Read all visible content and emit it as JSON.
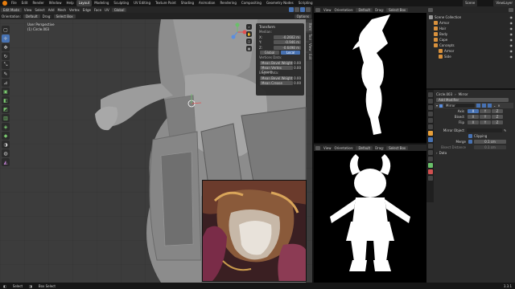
{
  "menu": {
    "items": [
      "File",
      "Edit",
      "Render",
      "Window",
      "Help"
    ],
    "workspaces": [
      "Layout",
      "Modeling",
      "Sculpting",
      "UV Editing",
      "Texture Paint",
      "Shading",
      "Animation",
      "Rendering",
      "Compositing",
      "Geometry Nodes",
      "Scripting"
    ],
    "active_workspace": "Layout",
    "scene_label": "Scene",
    "view_layer_label": "ViewLayer"
  },
  "viewport": {
    "mode": "Edit Mode",
    "menus": [
      "View",
      "Select",
      "Add",
      "Mesh",
      "Vertex",
      "Edge",
      "Face",
      "UV"
    ],
    "orientation_label": "Orientation:",
    "orientation_value": "Default",
    "drag_label": "Drag:",
    "drag_value": "Select Box",
    "transform_global": "Global",
    "options_label": "Options",
    "view_name": "User Perspective",
    "object_name": "(1) Circle.003"
  },
  "npanel": {
    "header": "Transform",
    "median_label": "Median:",
    "x_label": "X:",
    "x_value": "-0.2602 m",
    "y_label": "Y:",
    "y_value": "-0.946 m",
    "z_label": "Z:",
    "z_value": "-0.6498 m",
    "global_btn": "Global",
    "local_btn": "Local",
    "vertices_data": "Vertices Data:",
    "mean_bevel_weight_v": "Mean Bevel Weight",
    "mean_bevel_weight_v_val": "0.00",
    "mean_vertex_crease": "Mean Vertex Crease",
    "mean_vertex_crease_val": "0.00",
    "edges_data": "Edges Data:",
    "mean_bevel_weight_e": "Mean Bevel Weight",
    "mean_bevel_weight_e_val": "0.00",
    "mean_crease": "Mean Crease",
    "mean_crease_val": "0.00",
    "tabs": [
      "Item",
      "Tool",
      "View",
      "Edit"
    ]
  },
  "image_editor_top": {
    "view_menu": "View",
    "orientation_label": "Orientation:",
    "orientation_value": "Default",
    "drag_label": "Drag:",
    "drag_value": "Select Box"
  },
  "image_editor_bottom": {
    "view_menu": "View",
    "orientation_label": "Orientation:",
    "orientation_value": "Default",
    "drag_label": "Drag:",
    "drag_value": "Select Box"
  },
  "outliner": {
    "items": [
      {
        "label": "Scene Collection",
        "indent": 0,
        "color": "#9a9a9a"
      },
      {
        "label": "Armor",
        "indent": 1,
        "color": "#d9913c"
      },
      {
        "label": "Hair",
        "indent": 1,
        "color": "#d9913c"
      },
      {
        "label": "Body",
        "indent": 1,
        "color": "#d9913c"
      },
      {
        "label": "Cape",
        "indent": 1,
        "color": "#d9913c"
      },
      {
        "label": "Concepts",
        "indent": 1,
        "color": "#d9913c"
      },
      {
        "label": "Armor",
        "indent": 2,
        "color": "#d9913c"
      },
      {
        "label": "Side",
        "indent": 2,
        "color": "#d9913c"
      }
    ]
  },
  "properties": {
    "object_name": "Circle.003",
    "modifier_name_top": "Mirror",
    "add_modifier": "Add Modifier",
    "modifier_name": "Mirror",
    "axis_label": "Axis",
    "bisect_label": "Bisect",
    "flip_label": "Flip",
    "x": "X",
    "y": "Y",
    "z": "Z",
    "mirror_object_label": "Mirror Object",
    "clipping_label": "Clipping",
    "merge_label": "Merge",
    "merge_value": "0.1 cm",
    "bisect_distance_label": "Bisect Distance",
    "bisect_distance_value": "0.1 cm",
    "data_label": "Data"
  },
  "status": {
    "select": "Select",
    "box_select": "Box Select",
    "version": "3.3.1"
  },
  "colors": {
    "accent": "#4772b3",
    "header_bg": "#262626",
    "viewport_bg": "#3c3c3c",
    "orange": "#e87d0d"
  }
}
